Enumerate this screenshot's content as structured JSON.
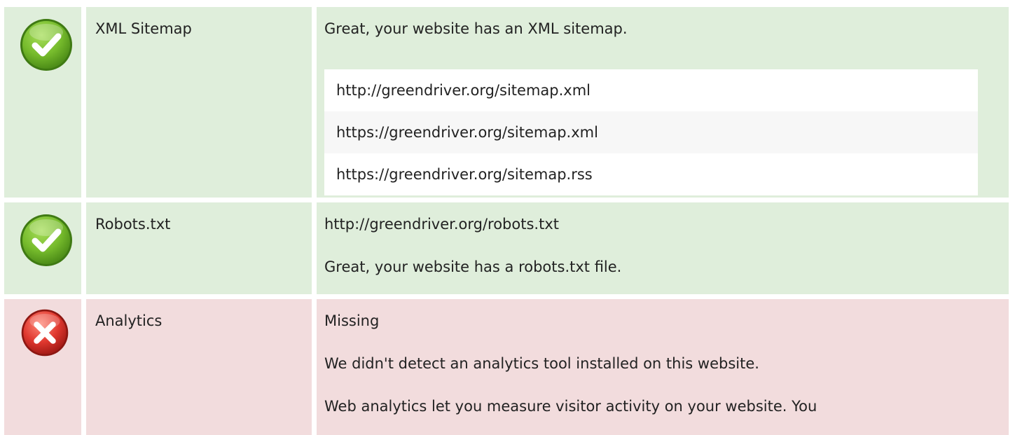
{
  "colors": {
    "pass_bg": "#dfeedb",
    "fail_bg": "#f2dcdd",
    "pass_icon": "#6fb62c",
    "fail_icon": "#d8302d"
  },
  "rows": [
    {
      "status": "pass",
      "icon": "check-circle-icon",
      "name": "XML Sitemap",
      "summary": "Great, your website has an XML sitemap.",
      "urls": [
        "http://greendriver.org/sitemap.xml",
        "https://greendriver.org/sitemap.xml",
        "https://greendriver.org/sitemap.rss"
      ]
    },
    {
      "status": "pass",
      "icon": "check-circle-icon",
      "name": "Robots.txt",
      "lines": [
        "http://greendriver.org/robots.txt",
        "Great, your website has a robots.txt file."
      ]
    },
    {
      "status": "fail",
      "icon": "cross-circle-icon",
      "name": "Analytics",
      "lines": [
        "Missing",
        "We didn't detect an analytics tool installed on this website.",
        "Web analytics let you measure visitor activity on your website. You"
      ]
    }
  ]
}
